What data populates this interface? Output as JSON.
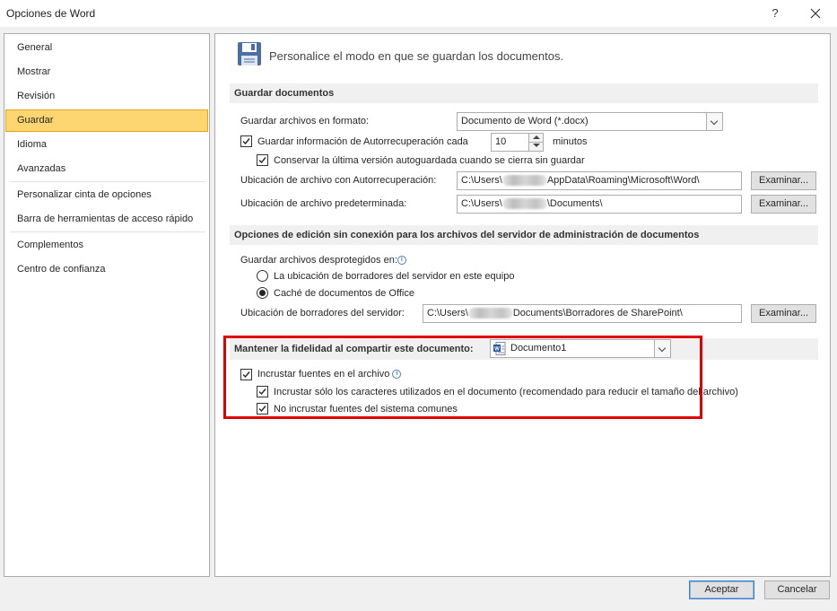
{
  "window": {
    "title": "Opciones de Word",
    "help_label": "?"
  },
  "sidebar": {
    "items": [
      {
        "label": "General"
      },
      {
        "label": "Mostrar"
      },
      {
        "label": "Revisión"
      },
      {
        "label": "Guardar"
      },
      {
        "label": "Idioma"
      },
      {
        "label": "Avanzadas"
      },
      {
        "label": "Personalizar cinta de opciones"
      },
      {
        "label": "Barra de herramientas de acceso rápido"
      },
      {
        "label": "Complementos"
      },
      {
        "label": "Centro de confianza"
      }
    ],
    "selected": "Guardar"
  },
  "header": {
    "text": "Personalice el modo en que se guardan los documentos."
  },
  "save_docs": {
    "heading": "Guardar documentos",
    "format_label": "Guardar archivos en formato:",
    "format_value": "Documento de Word (*.docx)",
    "autorecover_label": "Guardar información de Autorrecuperación cada",
    "autorecover_checked": true,
    "autorecover_minutes": "10",
    "minutes_label": "minutos",
    "keep_last_label": "Conservar la última versión autoguardada cuando se cierra sin guardar",
    "keep_last_checked": true,
    "autorecover_location_label": "Ubicación de archivo con Autorrecuperación:",
    "autorecover_location_prefix": "C:\\Users\\",
    "autorecover_location_suffix": "AppData\\Roaming\\Microsoft\\Word\\",
    "default_location_label": "Ubicación de archivo predeterminada:",
    "default_location_prefix": "C:\\Users\\",
    "default_location_suffix": "\\Documents\\",
    "browse_label": "Examinar..."
  },
  "offline_editing": {
    "heading": "Opciones de edición sin conexión para los archivos del servidor de administración de documentos",
    "checked_out_label": "Guardar archivos desprotegidos en:",
    "radio_server_label": "La ubicación de borradores del servidor en este equipo",
    "radio_server_selected": false,
    "radio_cache_label": "Caché de documentos de Office",
    "radio_cache_selected": true,
    "drafts_location_label": "Ubicación de borradores del servidor:",
    "drafts_location_prefix": "C:\\Users\\",
    "drafts_location_suffix": "Documents\\Borradores de SharePoint\\",
    "browse_label": "Examinar..."
  },
  "fidelity": {
    "heading": "Mantener la fidelidad al compartir este documento:",
    "document_value": "Documento1",
    "embed_fonts_label": "Incrustar fuentes en el archivo",
    "embed_fonts_checked": true,
    "embed_used_label": "Incrustar sólo los caracteres utilizados en el documento (recomendado para reducir el tamaño del archivo)",
    "embed_used_checked": true,
    "no_system_label": "No incrustar fuentes del sistema comunes",
    "no_system_checked": true
  },
  "footer": {
    "accept_label": "Aceptar",
    "cancel_label": "Cancelar"
  },
  "colors": {
    "selected_nav_bg": "#fdd671",
    "highlight_border": "#e00000",
    "save_icon": "#4a6fa5"
  },
  "icons": {
    "save": "floppy-disk-icon",
    "info": "info-icon",
    "word_doc": "word-document-icon",
    "close": "close-icon"
  }
}
